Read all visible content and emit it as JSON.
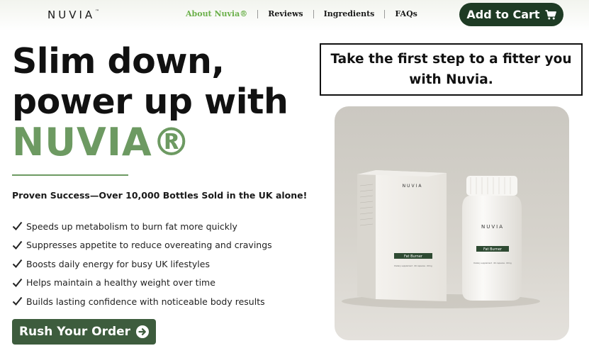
{
  "header": {
    "logo": "NUVIA",
    "logo_mark": "™",
    "nav": [
      {
        "label": "About Nuvia®",
        "active": true
      },
      {
        "label": "Reviews",
        "active": false
      },
      {
        "label": "Ingredients",
        "active": false
      },
      {
        "label": "FAQs",
        "active": false
      }
    ],
    "cart_label": "Add to Cart",
    "cart_icon": "shopping-cart-icon"
  },
  "hero": {
    "title_line1": "Slim down,",
    "title_line2": "power up with",
    "title_brand": "NUVIA®",
    "proof": "Proven Success—Over 10,000 Bottles Sold in the UK alone!",
    "benefits": [
      "Speeds up metabolism to burn fat more quickly",
      "Suppresses appetite to reduce overeating and cravings",
      "Boosts daily energy for busy UK lifestyles",
      "Helps maintain a healthy weight over time",
      "Builds lasting confidence with noticeable body results"
    ],
    "cta_label": "Rush Your Order",
    "cta_icon": "arrow-right-circle-icon"
  },
  "right": {
    "tagline": "Take the first step to a fitter you with Nuvia.",
    "product": {
      "box_brand": "NUVIA",
      "box_label": "Fat Burner",
      "box_small": "Dietary supplement · 60 capsules · 60 kg",
      "bottle_brand": "NUVIA",
      "bottle_label": "Fat Burner",
      "bottle_small": "Dietary supplement · 60 capsules · 60 kg"
    }
  },
  "colors": {
    "accent_green": "#6d9a62",
    "nav_active": "#6bb04a",
    "cart_bg": "#1e3b24",
    "cta_bg": "#3d5c3d"
  }
}
